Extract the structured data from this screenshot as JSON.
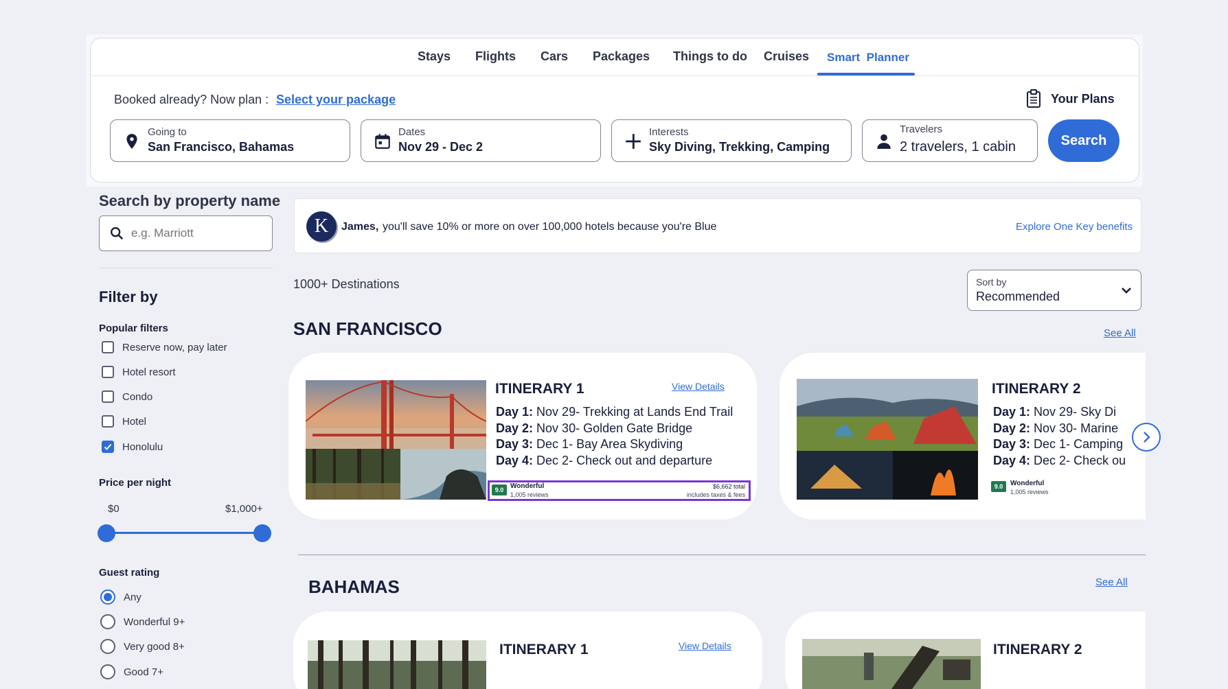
{
  "nav": {
    "tabs": [
      {
        "label": "Stays"
      },
      {
        "label": "Flights"
      },
      {
        "label": "Cars"
      },
      {
        "label": "Packages"
      },
      {
        "label": "Things to do"
      },
      {
        "label": "Cruises"
      },
      {
        "label": "Smart  Planner",
        "active": true
      }
    ]
  },
  "booked": {
    "text": "Booked already? Now plan :",
    "link": "Select your package"
  },
  "your_plans": "Your Plans",
  "search": {
    "going_to": {
      "label": "Going to",
      "value": "San Francisco, Bahamas"
    },
    "dates": {
      "label": "Dates",
      "value": "Nov 29 - Dec 2"
    },
    "interests": {
      "label": "Interests",
      "value": "Sky Diving, Trekking, Camping"
    },
    "travelers": {
      "label": "Travelers",
      "value": "2 travelers, 1 cabin"
    },
    "button": "Search"
  },
  "sidebar": {
    "property_title": "Search by property name",
    "property_placeholder": "e.g. Marriott",
    "filter_title": "Filter by",
    "popular_title": "Popular filters",
    "popular": [
      {
        "label": "Reserve now, pay later",
        "checked": false
      },
      {
        "label": "Hotel resort",
        "checked": false
      },
      {
        "label": "Condo",
        "checked": false
      },
      {
        "label": "Hotel",
        "checked": false
      },
      {
        "label": "Honolulu",
        "checked": true
      }
    ],
    "price_title": "Price per night",
    "price_min": "$0",
    "price_max": "$1,000+",
    "rating_title": "Guest rating",
    "ratings": [
      {
        "label": "Any",
        "checked": true
      },
      {
        "label": "Wonderful 9+",
        "checked": false
      },
      {
        "label": "Very good 8+",
        "checked": false
      },
      {
        "label": "Good 7+",
        "checked": false
      }
    ]
  },
  "onekey": {
    "logo": "K",
    "name": "James,",
    "message": "you'll save 10% or more on over 100,000 hotels because you're Blue",
    "link": "Explore One Key benefits"
  },
  "results": {
    "count": "1000+ Destinations",
    "sort_label": "Sort by",
    "sort_value": "Recommended"
  },
  "sections": [
    {
      "title": "SAN FRANCISCO",
      "see_all": "See All",
      "cards": [
        {
          "title": "ITINERARY 1",
          "view_details": "View Details",
          "days": [
            {
              "day": "Day 1:",
              "text": "Nov 29- Trekking at Lands End Trail"
            },
            {
              "day": "Day 2:",
              "text": "Nov 30- Golden Gate Bridge"
            },
            {
              "day": "Day 3:",
              "text": "Dec 1- Bay Area Skydiving"
            },
            {
              "day": "Day 4:",
              "text": "Dec 2- Check out and departure"
            }
          ],
          "rating": "9.0",
          "rating_word": "Wonderful",
          "reviews": "1,005 reviews",
          "price_total": "$6,662 total",
          "price_note": "includes taxes & fees"
        },
        {
          "title": "ITINERARY 2",
          "days": [
            {
              "day": "Day 1:",
              "text": "Nov 29- Sky Di"
            },
            {
              "day": "Day 2:",
              "text": "Nov 30- Marine"
            },
            {
              "day": "Day 3:",
              "text": "Dec 1- Camping"
            },
            {
              "day": "Day 4:",
              "text": "Dec 2- Check ou"
            }
          ],
          "rating": "9.0",
          "rating_word": "Wonderful",
          "reviews": "1,005 reviews"
        }
      ]
    },
    {
      "title": "BAHAMAS",
      "see_all": "See All",
      "cards": [
        {
          "title": "ITINERARY 1",
          "view_details": "View Details"
        },
        {
          "title": "ITINERARY 2"
        }
      ]
    }
  ],
  "colors": {
    "accent": "#2f6cd8",
    "rating_green": "#227950",
    "highlight": "#7a35d9",
    "background": "#eef0f5"
  },
  "icons": [
    "clipboard-icon",
    "location-pin-icon",
    "calendar-icon",
    "plus-icon",
    "person-icon",
    "search-icon",
    "chevron-down-icon",
    "chevron-right-icon",
    "check-icon"
  ]
}
